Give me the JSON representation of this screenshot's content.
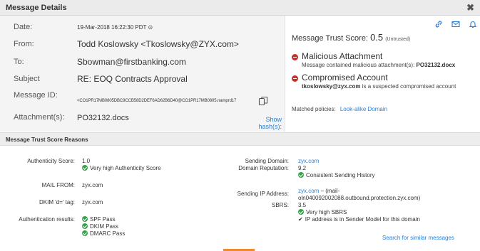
{
  "window": {
    "title": "Message Details",
    "close_glyph": "✖"
  },
  "header": {
    "date_label": "Date:",
    "date_value": "19-Mar-2018 16:22:30 PDT ⊙",
    "from_label": "From:",
    "from_value": "Todd Koslowsky <Tkoslowsky@ZYX.com>",
    "to_label": "To:",
    "to_value": "Sbowman@firstbanking.com",
    "subject_label": "Subject",
    "subject_value": "RE: EOQ Contracts Approval",
    "message_id_label": "Message ID:",
    "message_id_value": "<CO1PR17MB0805DBC9CCB58D2DEF6AD62B6D40@CO1PR17MB0805.namprd17",
    "attachments_label": "Attachment(s):",
    "attachments_value": "PO32132.docs",
    "show_hash": "Show hash(s):"
  },
  "trust": {
    "label": "Message Trust Score:",
    "score": "0.5",
    "tag": "(Untrusted)",
    "threats": [
      {
        "title": "Malicious Attachment",
        "desc_prefix": "Message contained malicious attachment(s): ",
        "desc_bold": "PO32132.docx",
        "desc_suffix": ""
      },
      {
        "title": "Compromised Account",
        "desc_prefix": "",
        "desc_bold": "tkoslowsky@zyx.com",
        "desc_suffix": " is a suspected compromised account"
      }
    ],
    "policies_label": "Matched policies:",
    "policies_link": "Look-alike Domain"
  },
  "reasons": {
    "title": "Message Trust Score Reasons",
    "authenticity_label": "Authenticity Score:",
    "authenticity_value": "1.0",
    "authenticity_note": "Very high Authenticity Score",
    "mail_from_label": "MAIL FROM:",
    "mail_from_value": "zyx.com",
    "dkim_label": "DKIM 'd=' tag:",
    "dkim_value": "zyx.com",
    "auth_results_label": "Authentication results:",
    "auth_results": [
      "SPF Pass",
      "DKIM Pass",
      "DMARC Pass"
    ],
    "sending_domain_label": "Sending Domain:",
    "sending_domain_value": "zyx.com",
    "domain_rep_label": "Domain Reputation:",
    "domain_rep_value": "9.2",
    "domain_rep_note": "Consistent Sending History",
    "sending_ip_label": "Sending IP Address:",
    "sending_ip_link": "zyx.com",
    "sending_ip_rest_1": " – (mail-",
    "sending_ip_rest_2": "oln040092002088.outbound.protection.zyx.com)",
    "sbrs_label": "SBRS:",
    "sbrs_value": "3.5",
    "sbrs_note": "Very high SBRS",
    "sender_model_note": "IP address is in Sender Model for this domain",
    "search_similar": "Search for similar messages"
  },
  "colors": {
    "accent": "#2a7fd4",
    "danger": "#c8312b",
    "ok": "#36a24b",
    "header_bg": "#f4f4f4"
  },
  "icons": [
    "link-icon",
    "mail-icon",
    "bell-icon",
    "copy-icon",
    "close-icon"
  ]
}
